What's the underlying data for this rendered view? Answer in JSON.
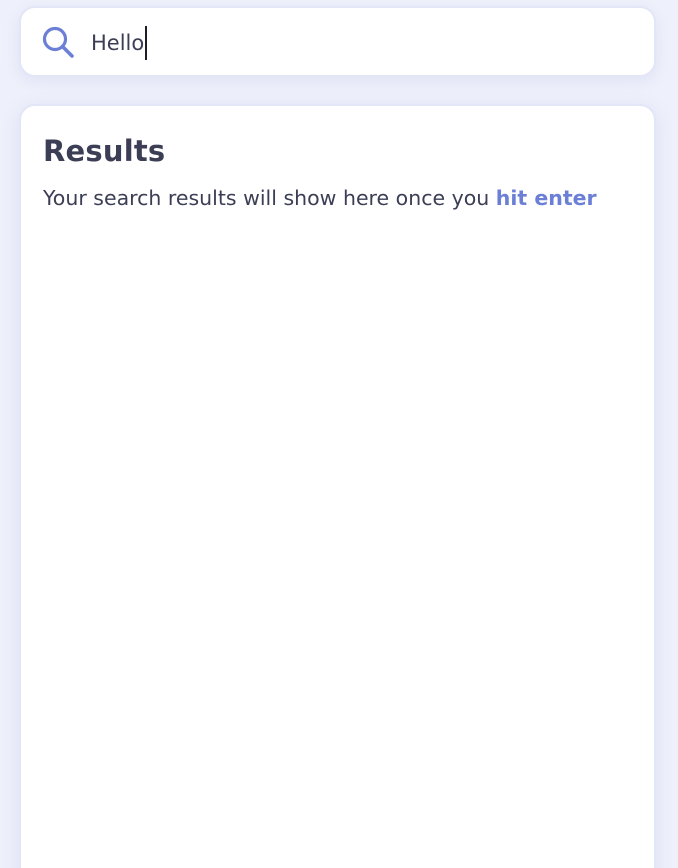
{
  "search": {
    "value": "Hello",
    "icon": "search-icon"
  },
  "results": {
    "title": "Results",
    "hint_prefix": "Your search results will show here once you ",
    "hint_action": "hit enter"
  },
  "colors": {
    "background": "#eef0fb",
    "card": "#ffffff",
    "text": "#3b3e55",
    "accent": "#6b7fd7"
  }
}
